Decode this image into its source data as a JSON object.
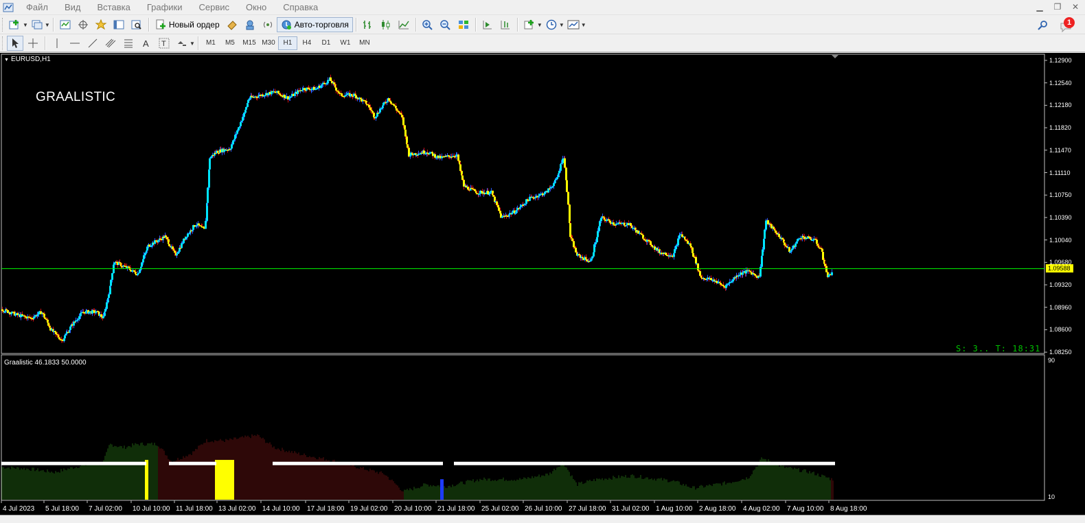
{
  "menu": {
    "items": [
      "Файл",
      "Вид",
      "Вставка",
      "Графики",
      "Сервис",
      "Окно",
      "Справка"
    ]
  },
  "toolbar": {
    "new_order_label": "Новый ордер",
    "autotrading_label": "Авто-торговля",
    "notification_count": "1"
  },
  "timeframes": [
    "M1",
    "M5",
    "M15",
    "M30",
    "H1",
    "H4",
    "D1",
    "W1",
    "MN"
  ],
  "active_timeframe": "H1",
  "chart": {
    "symbol_label": "EURUSD,H1",
    "overlay_title": "GRAALISTIC",
    "status_text": "S: 3.. T: 18:31",
    "current_price_tag": "1.09588",
    "price_axis": [
      "1.12900",
      "1.12540",
      "1.12180",
      "1.11820",
      "1.11470",
      "1.11110",
      "1.10750",
      "1.10390",
      "1.10040",
      "1.09680",
      "1.09320",
      "1.08960",
      "1.08600",
      "1.08250"
    ],
    "time_axis": [
      "4 Jul 2023",
      "5 Jul 18:00",
      "7 Jul 02:00",
      "10 Jul 10:00",
      "11 Jul 18:00",
      "13 Jul 02:00",
      "14 Jul 10:00",
      "17 Jul 18:00",
      "19 Jul 02:00",
      "20 Jul 10:00",
      "21 Jul 18:00",
      "25 Jul 02:00",
      "26 Jul 10:00",
      "27 Jul 18:00",
      "31 Jul 02:00",
      "1 Aug 10:00",
      "2 Aug 18:00",
      "4 Aug 02:00",
      "7 Aug 10:00",
      "8 Aug 18:00"
    ],
    "colors": {
      "background": "#000000",
      "bull_candle": "#00e5ff",
      "bear_candle": "#ffff00",
      "price_line": "#00ff00",
      "hist_green": "#1f5c12",
      "hist_red": "#5c0f0f"
    }
  },
  "indicator": {
    "label": "Graalistic 46.1833 50.0000",
    "axis_max": "90",
    "axis_min": "10"
  },
  "chart_data": {
    "type": "line",
    "symbol": "EURUSD",
    "timeframe": "H1",
    "ylim": [
      1.0825,
      1.1295
    ],
    "current_price": 1.09588,
    "price_path": [
      [
        0,
        1.0895
      ],
      [
        25,
        1.0885
      ],
      [
        45,
        1.088
      ],
      [
        60,
        1.089
      ],
      [
        75,
        1.086
      ],
      [
        90,
        1.0845
      ],
      [
        105,
        1.087
      ],
      [
        120,
        1.089
      ],
      [
        140,
        1.089
      ],
      [
        150,
        1.088
      ],
      [
        160,
        1.093
      ],
      [
        165,
        1.097
      ],
      [
        185,
        1.096
      ],
      [
        200,
        1.095
      ],
      [
        215,
        1.0995
      ],
      [
        240,
        1.101
      ],
      [
        255,
        1.098
      ],
      [
        270,
        1.101
      ],
      [
        285,
        1.103
      ],
      [
        298,
        1.102
      ],
      [
        305,
        1.1135
      ],
      [
        315,
        1.1145
      ],
      [
        335,
        1.115
      ],
      [
        355,
        1.1205
      ],
      [
        362,
        1.123
      ],
      [
        380,
        1.1235
      ],
      [
        400,
        1.124
      ],
      [
        420,
        1.123
      ],
      [
        440,
        1.1245
      ],
      [
        460,
        1.1245
      ],
      [
        480,
        1.126
      ],
      [
        495,
        1.1235
      ],
      [
        515,
        1.1235
      ],
      [
        535,
        1.122
      ],
      [
        545,
        1.12
      ],
      [
        565,
        1.123
      ],
      [
        585,
        1.12
      ],
      [
        595,
        1.114
      ],
      [
        620,
        1.1145
      ],
      [
        640,
        1.1135
      ],
      [
        665,
        1.114
      ],
      [
        675,
        1.109
      ],
      [
        695,
        1.108
      ],
      [
        715,
        1.108
      ],
      [
        730,
        1.104
      ],
      [
        750,
        1.105
      ],
      [
        770,
        1.107
      ],
      [
        795,
        1.108
      ],
      [
        810,
        1.11
      ],
      [
        820,
        1.114
      ],
      [
        825,
        1.109
      ],
      [
        830,
        1.101
      ],
      [
        840,
        1.098
      ],
      [
        860,
        1.097
      ],
      [
        875,
        1.104
      ],
      [
        895,
        1.103
      ],
      [
        915,
        1.103
      ],
      [
        940,
        1.1005
      ],
      [
        960,
        1.0985
      ],
      [
        980,
        1.098
      ],
      [
        990,
        1.1015
      ],
      [
        1005,
        1.0995
      ],
      [
        1020,
        1.0945
      ],
      [
        1040,
        1.094
      ],
      [
        1055,
        1.093
      ],
      [
        1075,
        1.095
      ],
      [
        1090,
        1.0955
      ],
      [
        1105,
        1.0945
      ],
      [
        1115,
        1.1035
      ],
      [
        1135,
        1.101
      ],
      [
        1150,
        1.0985
      ],
      [
        1165,
        1.101
      ],
      [
        1185,
        1.1005
      ],
      [
        1195,
        1.099
      ],
      [
        1205,
        1.0945
      ],
      [
        1212,
        1.0955
      ]
    ],
    "indicator_hist": [
      [
        0,
        29
      ],
      [
        40,
        28
      ],
      [
        80,
        26
      ],
      [
        120,
        30
      ],
      [
        150,
        31
      ],
      [
        160,
        42
      ],
      [
        180,
        40
      ],
      [
        200,
        42
      ],
      [
        230,
        42
      ],
      [
        250,
        32
      ],
      [
        280,
        37
      ],
      [
        300,
        44
      ],
      [
        330,
        44
      ],
      [
        375,
        47
      ],
      [
        400,
        40
      ],
      [
        440,
        36
      ],
      [
        480,
        33
      ],
      [
        520,
        29
      ],
      [
        560,
        25
      ],
      [
        588,
        15
      ],
      [
        620,
        19
      ],
      [
        650,
        18
      ],
      [
        700,
        22
      ],
      [
        760,
        22
      ],
      [
        800,
        25
      ],
      [
        820,
        32
      ],
      [
        840,
        19
      ],
      [
        870,
        22
      ],
      [
        920,
        24
      ],
      [
        980,
        21
      ],
      [
        1010,
        17
      ],
      [
        1060,
        20
      ],
      [
        1090,
        23
      ],
      [
        1110,
        34
      ],
      [
        1140,
        29
      ],
      [
        1180,
        26
      ],
      [
        1212,
        22
      ]
    ],
    "hist_sign": [
      [
        0,
        230,
        "green"
      ],
      [
        230,
        588,
        "red"
      ],
      [
        588,
        1210,
        "green"
      ],
      [
        1210,
        1215,
        "red"
      ]
    ],
    "white_segments": [
      [
        2,
        213
      ],
      [
        246,
        315
      ],
      [
        397,
        645
      ],
      [
        661,
        1216
      ]
    ],
    "white_level": 31,
    "yellow_bars": [
      [
        211,
        216,
        33
      ],
      [
        313,
        341,
        33
      ]
    ],
    "blue_bars": [
      [
        641,
        646,
        22
      ]
    ],
    "ind_ylim": [
      10,
      90
    ]
  }
}
